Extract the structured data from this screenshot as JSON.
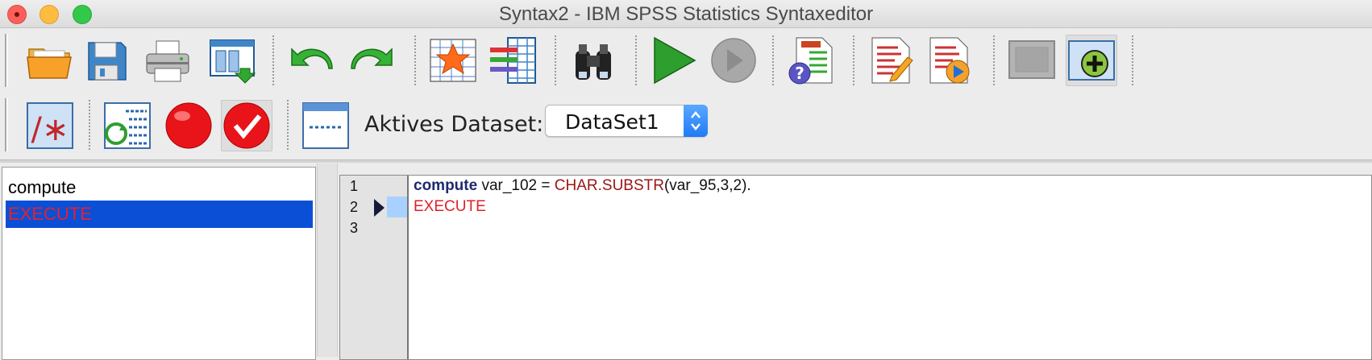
{
  "window": {
    "title": "Syntax2 - IBM SPSS Statistics Syntaxeditor"
  },
  "toolbar": {
    "row1_icons": [
      "open-folder-icon",
      "save-icon",
      "print-icon",
      "recall-dialog-icon",
      "undo-icon",
      "redo-icon",
      "goto-data-icon",
      "variables-icon",
      "find-icon",
      "run-icon",
      "stop-icon",
      "help-icon",
      "syntax-help-icon",
      "run-to-end-icon",
      "designate-window-icon",
      "add-icon"
    ],
    "row2_icons": [
      "comment-icon",
      "refresh-icon",
      "breakpoint-icon",
      "validate-icon",
      "window-icon"
    ],
    "dataset_label": "Aktives Dataset:",
    "dataset_value": "DataSet1"
  },
  "navigator": {
    "items": [
      {
        "label": "compute",
        "selected": false
      },
      {
        "label": "EXECUTE",
        "selected": true
      }
    ],
    "selected_bg": "#0a4fd6",
    "selected_fg": "#e8202a"
  },
  "editor": {
    "line_numbers": [
      "1",
      "2",
      "3"
    ],
    "current_line": 2,
    "lines": [
      {
        "keyword": "compute",
        "text1": " var_102 = ",
        "function": "CHAR.SUBSTR",
        "text2": "(var_95,3,2)."
      },
      {
        "keyword": "EXECUTE"
      }
    ],
    "colors": {
      "keyword": "#1e2a6e",
      "function": "#9a1515",
      "execute": "#e0202a",
      "current_line": "#a9d1ff"
    }
  }
}
